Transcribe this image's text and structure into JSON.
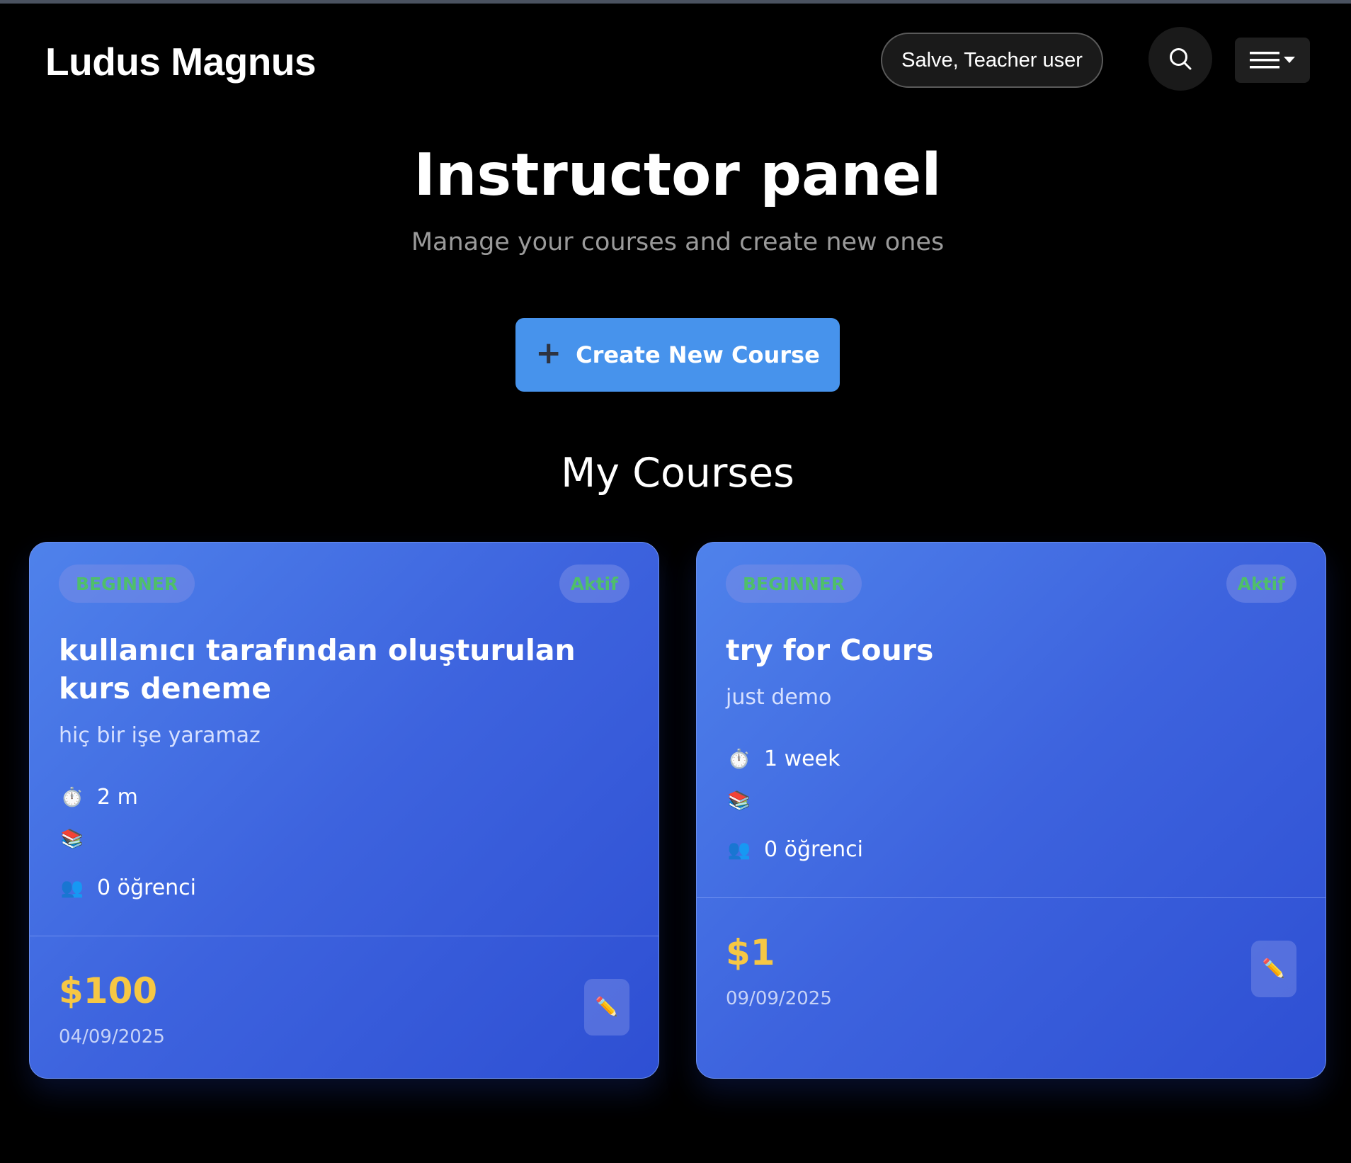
{
  "header": {
    "brand": "Ludus Magnus",
    "greeting": "Salve, Teacher user",
    "search_icon": "search-icon",
    "menu_icon": "hamburger-menu-icon"
  },
  "hero": {
    "title": "Instructor panel",
    "subtitle": "Manage your courses and create new ones",
    "create_button": "Create New Course",
    "create_icon": "+"
  },
  "section": {
    "title": "My Courses"
  },
  "courses": [
    {
      "level": "BEGINNER",
      "status": "Aktif",
      "title": "kullanıcı tarafından oluşturulan kurs deneme",
      "description": "hiç bir işe yaramaz",
      "duration_icon": "⏱️",
      "duration": "2 m",
      "lessons_icon": "📚",
      "lessons": "",
      "students_icon": "👥",
      "students": "0 öğrenci",
      "price": "$100",
      "date": "04/09/2025",
      "edit_icon": "✏️"
    },
    {
      "level": "BEGINNER",
      "status": "Aktif",
      "title": "try for Cours",
      "description": "just demo",
      "duration_icon": "⏱️",
      "duration": "1 week",
      "lessons_icon": "📚",
      "lessons": "",
      "students_icon": "👥",
      "students": "0 öğrenci",
      "price": "$1",
      "date": "09/09/2025",
      "edit_icon": "✏️"
    }
  ],
  "colors": {
    "background": "#000000",
    "accent": "#4793ec",
    "card": "#3d63de",
    "price": "#f6c744",
    "badge_text": "#4fbf6a"
  }
}
